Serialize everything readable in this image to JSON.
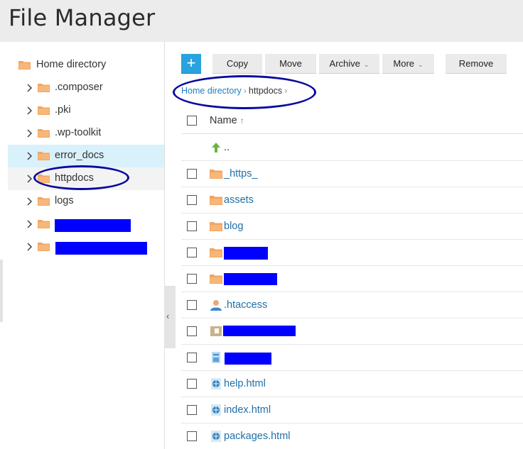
{
  "window": {
    "title": "File Manager"
  },
  "tree": {
    "root": {
      "label": "Home directory",
      "icon": "folder-icon"
    },
    "items": [
      {
        "label": ".composer",
        "state": ""
      },
      {
        "label": ".pki",
        "state": ""
      },
      {
        "label": ".wp-toolkit",
        "state": ""
      },
      {
        "label": "error_docs",
        "state": "selected"
      },
      {
        "label": "httpdocs",
        "state": "hover"
      },
      {
        "label": "logs",
        "state": ""
      },
      {
        "label": "",
        "state": "",
        "redacted": true
      },
      {
        "label": "",
        "state": "",
        "redacted": true
      }
    ]
  },
  "toolbar": {
    "add_label": "+",
    "copy_label": "Copy",
    "move_label": "Move",
    "archive_label": "Archive",
    "more_label": "More",
    "remove_label": "Remove"
  },
  "breadcrumb": {
    "home": "Home directory",
    "current": "httpdocs",
    "separator": "›"
  },
  "table": {
    "header": {
      "name": "Name",
      "sort": "↑"
    },
    "rows": [
      {
        "name": "..",
        "icon": "parent-dir-up-icon",
        "checkbox": false
      },
      {
        "name": "_https_",
        "icon": "folder-icon",
        "checkbox": true
      },
      {
        "name": "assets",
        "icon": "folder-icon",
        "checkbox": true
      },
      {
        "name": "blog",
        "icon": "folder-icon",
        "checkbox": true
      },
      {
        "name": "",
        "icon": "folder-icon",
        "checkbox": true,
        "redacted": true
      },
      {
        "name": "",
        "icon": "folder-icon",
        "checkbox": true,
        "redacted": true
      },
      {
        "name": ".htaccess",
        "icon": "user-file-icon",
        "checkbox": true
      },
      {
        "name": "",
        "icon": "archive-file-icon",
        "checkbox": true,
        "redacted": true
      },
      {
        "name": "",
        "icon": "document-file-icon",
        "checkbox": true,
        "redacted": true
      },
      {
        "name": "help.html",
        "icon": "html-file-icon",
        "checkbox": true
      },
      {
        "name": "index.html",
        "icon": "html-file-icon",
        "checkbox": true
      },
      {
        "name": "packages.html",
        "icon": "html-file-icon",
        "checkbox": true
      }
    ]
  },
  "colors": {
    "accent": "#29a3dd",
    "link": "#1f6fa8",
    "folder": "#f4a460",
    "selected_row": "#d9f1fb",
    "redaction": "#0000ff",
    "annotation": "#0a0a9e"
  }
}
